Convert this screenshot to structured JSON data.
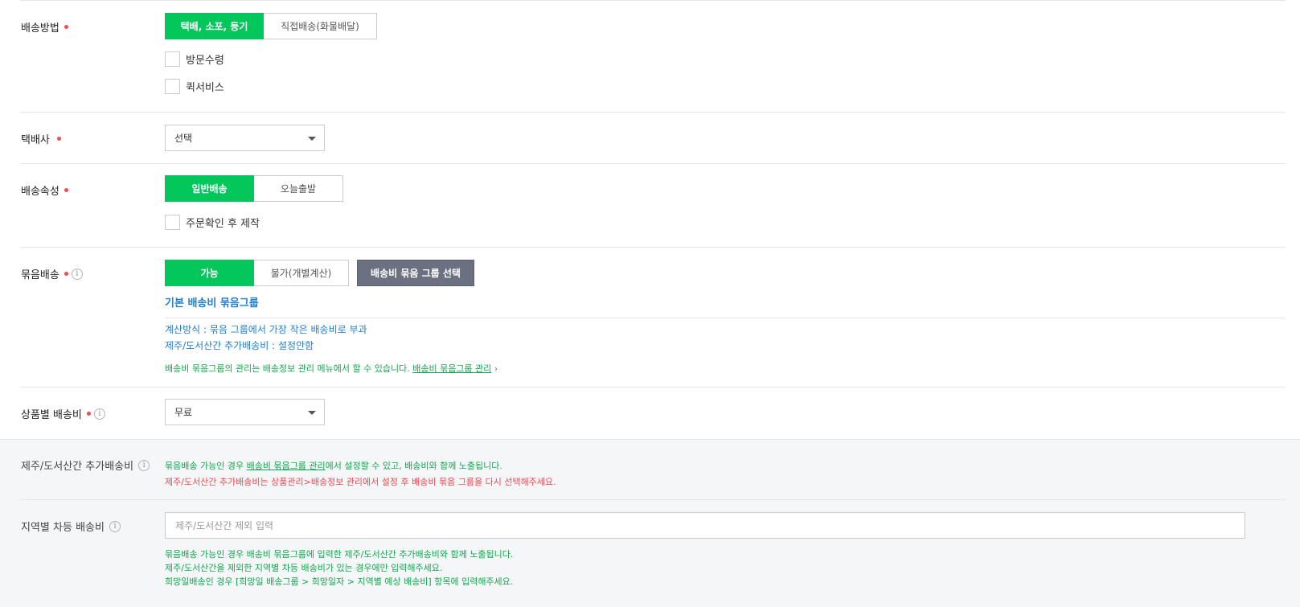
{
  "shipping_method": {
    "label": "배송방법",
    "options": [
      "택배, 소포, 등기",
      "직접배송(화물배달)"
    ],
    "checkboxes": [
      "방문수령",
      "퀵서비스"
    ]
  },
  "courier": {
    "label": "택배사",
    "selected": "선택"
  },
  "shipping_attr": {
    "label": "배송속성",
    "options": [
      "일반배송",
      "오늘출발"
    ],
    "checkbox": "주문확인 후 제작"
  },
  "bundle_shipping": {
    "label": "묶음배송",
    "options": [
      "가능",
      "불가(개별계산)"
    ],
    "group_button": "배송비 묶음 그룹 선택",
    "group_name": "기본 배송비 묶음그룹",
    "calc_method": "계산방식 : 묶음 그룹에서 가장 작은 배송비로 부과",
    "jeju_extra": "제주/도서산간 추가배송비 : 설정안함",
    "manage_note": "배송비 묶음그룹의 관리는 배송정보 관리 메뉴에서 할 수 있습니다.",
    "manage_link": "배송비 묶음그룹 관리",
    "manage_arrow": "›"
  },
  "product_fee": {
    "label": "상품별 배송비",
    "selected": "무료"
  },
  "jeju_fee": {
    "label": "제주/도서산간 추가배송비",
    "note_prefix": "묶음배송 가능인 경우 ",
    "note_link": "배송비 묶음그룹 관리",
    "note_suffix": "에서 설정할 수 있고, 배송비와 함께 노출됩니다.",
    "warning": "제주/도서산간 추가배송비는 상품관리>배송정보 관리에서 설정 후 배송비 묶음 그룹을 다시 선택해주세요."
  },
  "regional_fee": {
    "label": "지역별 차등 배송비",
    "placeholder": "제주/도서산간 제외 입력",
    "notes": [
      "묶음배송 가능인 경우 배송비 묶음그룹에 입력한 제주/도서산간 추가배송비와 함께 노출됩니다.",
      "제주/도서산간을 제외한 지역별 차등 배송비가 있는 경우에만 입력해주세요.",
      "희망일배송인 경우 [희망일 배송그룹 > 희망일자 > 지역별 예상 배송비] 항목에 입력해주세요."
    ]
  },
  "icons": {
    "info": "i",
    "required": "required-dot"
  },
  "colors": {
    "accent": "#03c75a",
    "link_blue": "#1f7ecf",
    "note_green": "#12a84e",
    "warning_red": "#f0484f",
    "dark_button": "#6b7181"
  }
}
